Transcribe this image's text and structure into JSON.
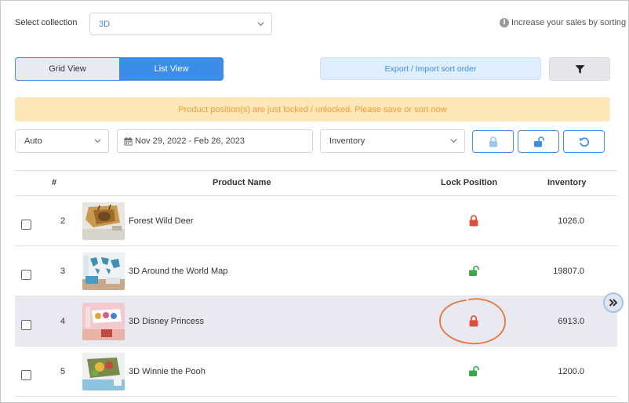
{
  "collection": {
    "label": "Select collection",
    "value": "3D"
  },
  "hint": {
    "text": "Increase your sales by sorting"
  },
  "view_toggle": {
    "grid": "Grid View",
    "list": "List View",
    "active": "list"
  },
  "export_button": {
    "label": "Export / Import sort order"
  },
  "banner": {
    "text": "Product position(s) are just locked / unlocked. Please save or sort now"
  },
  "filters": {
    "mode": "Auto",
    "date_range": "Nov 29, 2022 - Feb 26, 2023",
    "sort_by": "Inventory"
  },
  "table": {
    "headers": {
      "index": "#",
      "name": "Product Name",
      "lock": "Lock Position",
      "inventory": "Inventory"
    },
    "rows": [
      {
        "index": "2",
        "name": "Forest Wild Deer",
        "locked": true,
        "inventory": "1026.0",
        "highlight": false
      },
      {
        "index": "3",
        "name": "3D Around the World Map",
        "locked": false,
        "inventory": "19807.0",
        "highlight": false
      },
      {
        "index": "4",
        "name": "3D Disney Princess",
        "locked": true,
        "inventory": "6913.0",
        "highlight": true
      },
      {
        "index": "5",
        "name": "3D Winnie the Pooh",
        "locked": false,
        "inventory": "1200.0",
        "highlight": false
      }
    ]
  },
  "colors": {
    "accent": "#3b8de8",
    "locked": "#e24a3b",
    "unlocked": "#3aa84a",
    "banner_bg": "#fde6b8",
    "banner_text": "#f39c38",
    "annotation": "#e8743a"
  },
  "icons": {
    "chevron": "chevron-down-icon",
    "info": "info-icon",
    "filter": "filter-icon",
    "calendar": "calendar-icon",
    "lock": "lock-icon",
    "unlock": "unlock-icon",
    "reset": "reset-icon",
    "next": "double-chevron-right-icon"
  }
}
